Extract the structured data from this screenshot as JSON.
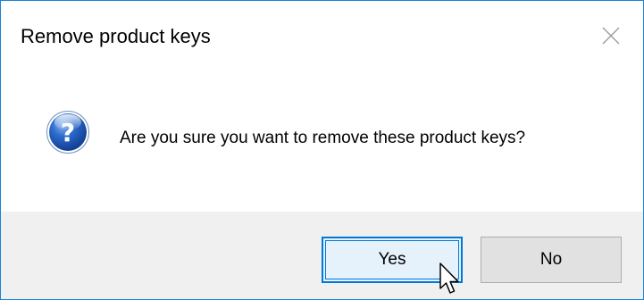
{
  "dialog": {
    "title": "Remove product keys",
    "message": "Are you sure you want to remove these product keys?",
    "icon": "question-icon",
    "close_icon": "close-icon"
  },
  "buttons": {
    "yes_label": "Yes",
    "no_label": "No",
    "default": "Yes"
  },
  "colors": {
    "accent": "#0078d7",
    "window_border": "#1883d7",
    "footer_bg": "#f0f0f0",
    "button_bg": "#e1e1e1",
    "question_icon_blue": "#1f5fbf"
  }
}
